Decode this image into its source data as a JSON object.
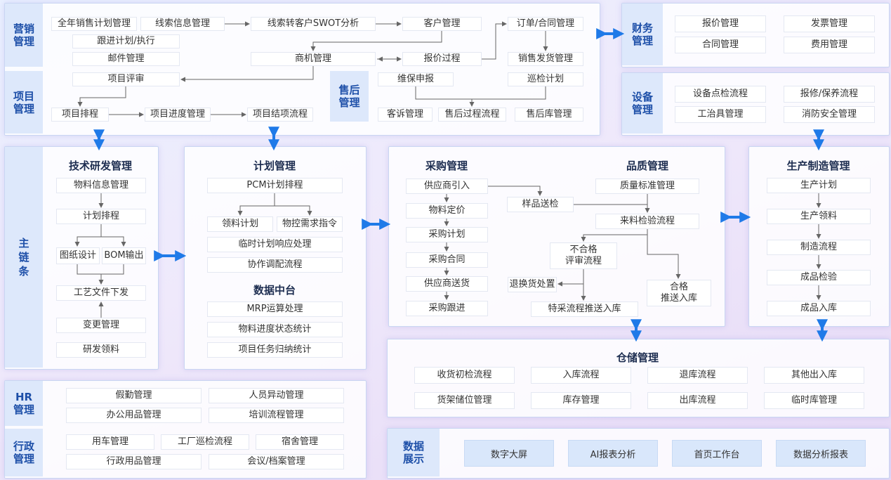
{
  "marketing": {
    "side_label": "营销\n管理",
    "items": {
      "annual_plan": "全年销售计划管理",
      "lead_info": "线索信息管理",
      "swot": "线索转客户SWOT分析",
      "customer": "客户管理",
      "order": "订单/合同管理",
      "follow_plan": "跟进计划/执行",
      "mail": "邮件管理",
      "opportunity": "商机管理",
      "quote_process": "报价过程",
      "sales_ship": "销售发货管理"
    }
  },
  "project": {
    "side_label": "项目\n管理",
    "items": {
      "review": "项目评审",
      "schedule": "项目排程",
      "progress": "项目进度管理",
      "closure": "项目结项流程"
    }
  },
  "after_sales": {
    "side_label": "售后\n管理",
    "items": {
      "repair_report": "维保申报",
      "inspection_plan": "巡检计划",
      "complaint": "客诉管理",
      "process": "售后过程流程",
      "warehouse": "售后库管理"
    }
  },
  "finance": {
    "side_label": "财务\n管理",
    "items": [
      "报价管理",
      "发票管理",
      "合同管理",
      "费用管理"
    ]
  },
  "equipment": {
    "side_label": "设备\n管理",
    "items": [
      "设备点检流程",
      "报修/保养流程",
      "工治具管理",
      "消防安全管理"
    ]
  },
  "main_chain": {
    "side_label": "主\n链\n条"
  },
  "rnd": {
    "title": "技术研发管理",
    "items": {
      "material": "物料信息管理",
      "plan": "计划排程",
      "drawing": "图纸设计",
      "bom": "BOM输出",
      "process_doc": "工艺文件下发",
      "change": "变更管理",
      "rnd_material": "研发领料"
    }
  },
  "planning": {
    "title": "计划管理",
    "items": {
      "pcm": "PCM计划排程",
      "pick_plan": "领料计划",
      "material_demand": "物控需求指令",
      "temp_plan": "临时计划响应处理",
      "coordination": "协作调配流程"
    },
    "data_center_title": "数据中台",
    "data_center": [
      "MRP运算处理",
      "物料进度状态统计",
      "项目任务归纳统计"
    ]
  },
  "purchasing": {
    "title": "采购管理",
    "items": [
      "供应商引入",
      "物料定价",
      "采购计划",
      "采购合同",
      "供应商送货",
      "采购跟进"
    ]
  },
  "quality": {
    "title": "品质管理",
    "items": {
      "standard": "质量标准管理",
      "sample": "样品送检",
      "incoming": "来料检验流程",
      "nonconform": "不合格\n评审流程",
      "return": "退换货处置",
      "qualified": "合格\n推送入库",
      "special": "特采流程推送入库"
    }
  },
  "production": {
    "title": "生产制造管理",
    "items": [
      "生产计划",
      "生产领料",
      "制造流程",
      "成品检验",
      "成品入库"
    ]
  },
  "warehouse": {
    "title": "仓储管理",
    "items": [
      "收货初检流程",
      "入库流程",
      "退库流程",
      "其他出入库",
      "货架储位管理",
      "库存管理",
      "出库流程",
      "临时库管理"
    ]
  },
  "hr": {
    "side_label": "HR\n管理",
    "items": [
      "假勤管理",
      "人员异动管理",
      "办公用品管理",
      "培训流程管理"
    ]
  },
  "admin": {
    "side_label": "行政\n管理",
    "items": [
      "用车管理",
      "工厂巡检流程",
      "宿舍管理",
      "行政用品管理",
      "会议/档案管理"
    ]
  },
  "data_display": {
    "side_label": "数据\n展示",
    "items": [
      "数字大屏",
      "AI报表分析",
      "首页工作台",
      "数据分析报表"
    ]
  },
  "colors": {
    "accent_blue": "#1f7ae8",
    "side_label_text": "#1d4fa8",
    "side_label_bg": "#dde8fb",
    "connector": "#666666"
  }
}
